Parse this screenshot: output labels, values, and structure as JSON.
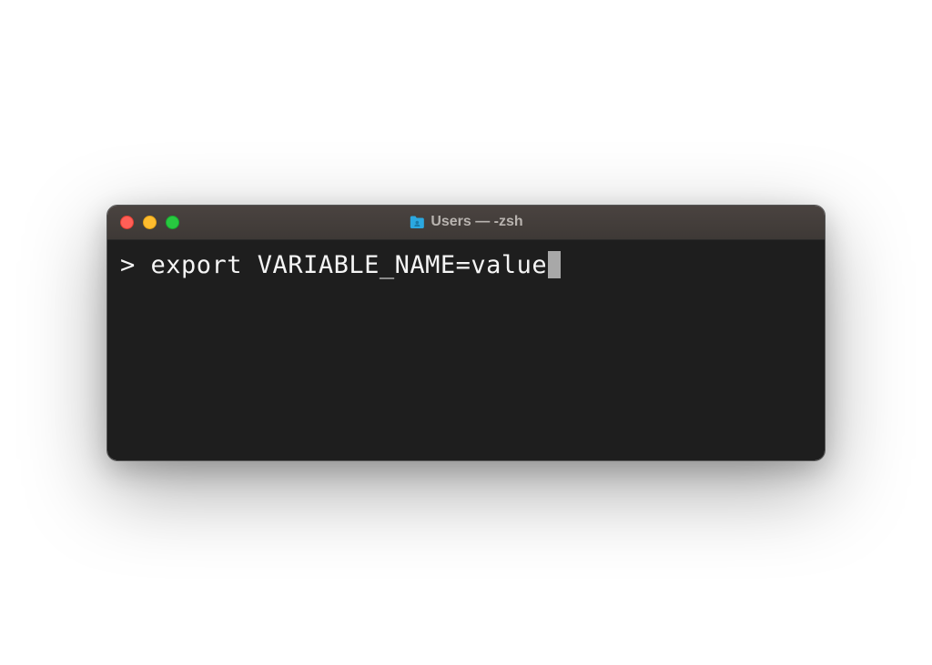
{
  "window": {
    "title": "Users — -zsh",
    "folder_icon_name": "folder-users-icon"
  },
  "terminal": {
    "prompt": "> ",
    "command": "export VARIABLE_NAME=value"
  },
  "colors": {
    "titlebar_bg": "#3e3936",
    "terminal_bg": "#1e1e1e",
    "text": "#f5f5f5",
    "traffic_red": "#ff5f57",
    "traffic_yellow": "#febc2e",
    "traffic_green": "#28c840",
    "folder_icon": "#2ba8e0"
  }
}
